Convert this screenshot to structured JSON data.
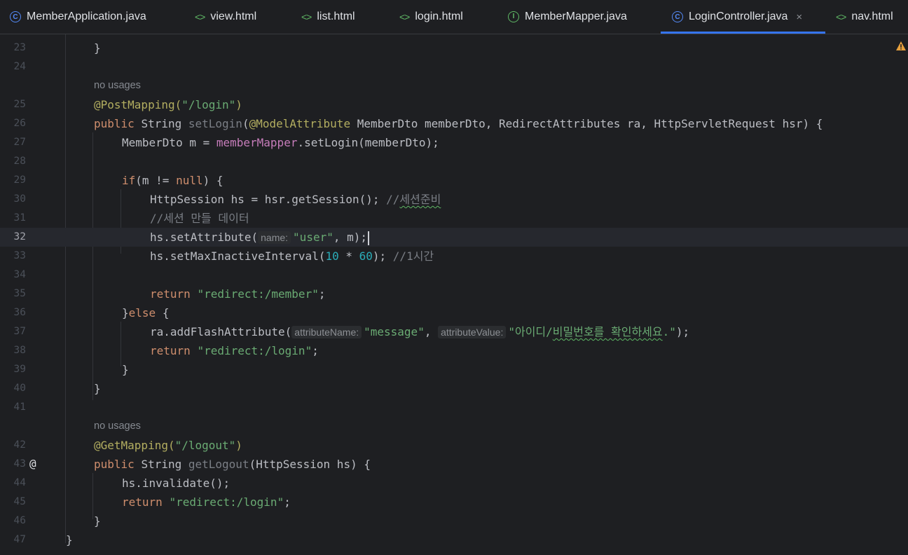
{
  "tabs": [
    {
      "label": "MemberApplication.java",
      "icon": "class-icon"
    },
    {
      "label": "view.html",
      "icon": "html-icon"
    },
    {
      "label": "list.html",
      "icon": "html-icon"
    },
    {
      "label": "login.html",
      "icon": "html-icon"
    },
    {
      "label": "MemberMapper.java",
      "icon": "interface-icon"
    },
    {
      "label": "LoginController.java",
      "icon": "class-icon",
      "active": true
    },
    {
      "label": "nav.html",
      "icon": "html-icon"
    }
  ],
  "tab_icons": {
    "class_glyph": "C",
    "interface_glyph": "I",
    "html_glyph": "<>",
    "close_glyph": "×"
  },
  "code": {
    "usage_hint": "no usages",
    "gutter_marker": "@",
    "lines": {
      "l23": {
        "num": "23",
        "t1": "}"
      },
      "l24": {
        "num": "24"
      },
      "l25": {
        "num": "25",
        "t1": "@PostMapping(",
        "t2": "\"/login\"",
        "t3": ")"
      },
      "l26": {
        "num": "26",
        "t1": "public ",
        "t2": "String ",
        "t3": "setLogin",
        "t4": "(",
        "t5": "@ModelAttribute ",
        "t6": "MemberDto memberDto, RedirectAttributes ra, HttpServletRequest hsr) {"
      },
      "l27": {
        "num": "27",
        "t1": "MemberDto m = ",
        "t2": "memberMapper",
        ".t3": "",
        "t3": ".setLogin(memberDto);"
      },
      "l28": {
        "num": "28"
      },
      "l29": {
        "num": "29",
        "t1": "if",
        "t2": "(m != ",
        "t3": "null",
        "t4": ") {"
      },
      "l30": {
        "num": "30",
        "t1": "HttpSession hs = hsr.getSession(); ",
        "t2": "//",
        "t3": "세션준비"
      },
      "l31": {
        "num": "31",
        "t1": "//세션 만들 데이터"
      },
      "l32": {
        "num": "32",
        "t1": "hs.setAttribute(",
        "hint": "name:",
        "t2": "\"user\"",
        "t3": ", m);"
      },
      "l33": {
        "num": "33",
        "t1": "hs.setMaxInactiveInterval(",
        "t2": "10",
        "t3": " * ",
        "t4": "60",
        "t5": "); ",
        "t6": "//1시간"
      },
      "l34": {
        "num": "34"
      },
      "l35": {
        "num": "35",
        "t1": "return ",
        "t2": "\"redirect:/member\"",
        "t3": ";"
      },
      "l36": {
        "num": "36",
        "t1": "}",
        "t2": "else ",
        "t3": "{"
      },
      "l37": {
        "num": "37",
        "t1": "ra.addFlashAttribute(",
        "hint1": "attributeName:",
        "t2": "\"message\"",
        "t3": ", ",
        "hint2": "attributeValue:",
        "t4": "\"아이디/",
        "t5": "비밀번호를 확인하세요",
        "t6": ".\"",
        "t7": ");"
      },
      "l38": {
        "num": "38",
        "t1": "return ",
        "t2": "\"redirect:/login\"",
        "t3": ";"
      },
      "l39": {
        "num": "39",
        "t1": "}"
      },
      "l40": {
        "num": "40",
        "t1": "}"
      },
      "l41": {
        "num": "41"
      },
      "l42": {
        "num": "42",
        "t1": "@GetMapping(",
        "t2": "\"/logout\"",
        "t3": ")"
      },
      "l43": {
        "num": "43",
        "t1": "public ",
        "t2": "String ",
        "t3": "getLogout",
        "t4": "(HttpSession hs) {"
      },
      "l44": {
        "num": "44",
        "t1": "hs.invalidate();"
      },
      "l45": {
        "num": "45",
        "t1": "return ",
        "t2": "\"redirect:/login\"",
        "t3": ";"
      },
      "l46": {
        "num": "46",
        "t1": "}"
      },
      "l47": {
        "num": "47",
        "t1": "}"
      }
    }
  },
  "colors": {
    "background": "#1e1f22",
    "keyword": "#cf8e6d",
    "annotation": "#b3ae60",
    "string": "#6aab73",
    "accent": "#3574f0",
    "warning": "#e6a03d"
  },
  "warning_icon": "warning-icon"
}
